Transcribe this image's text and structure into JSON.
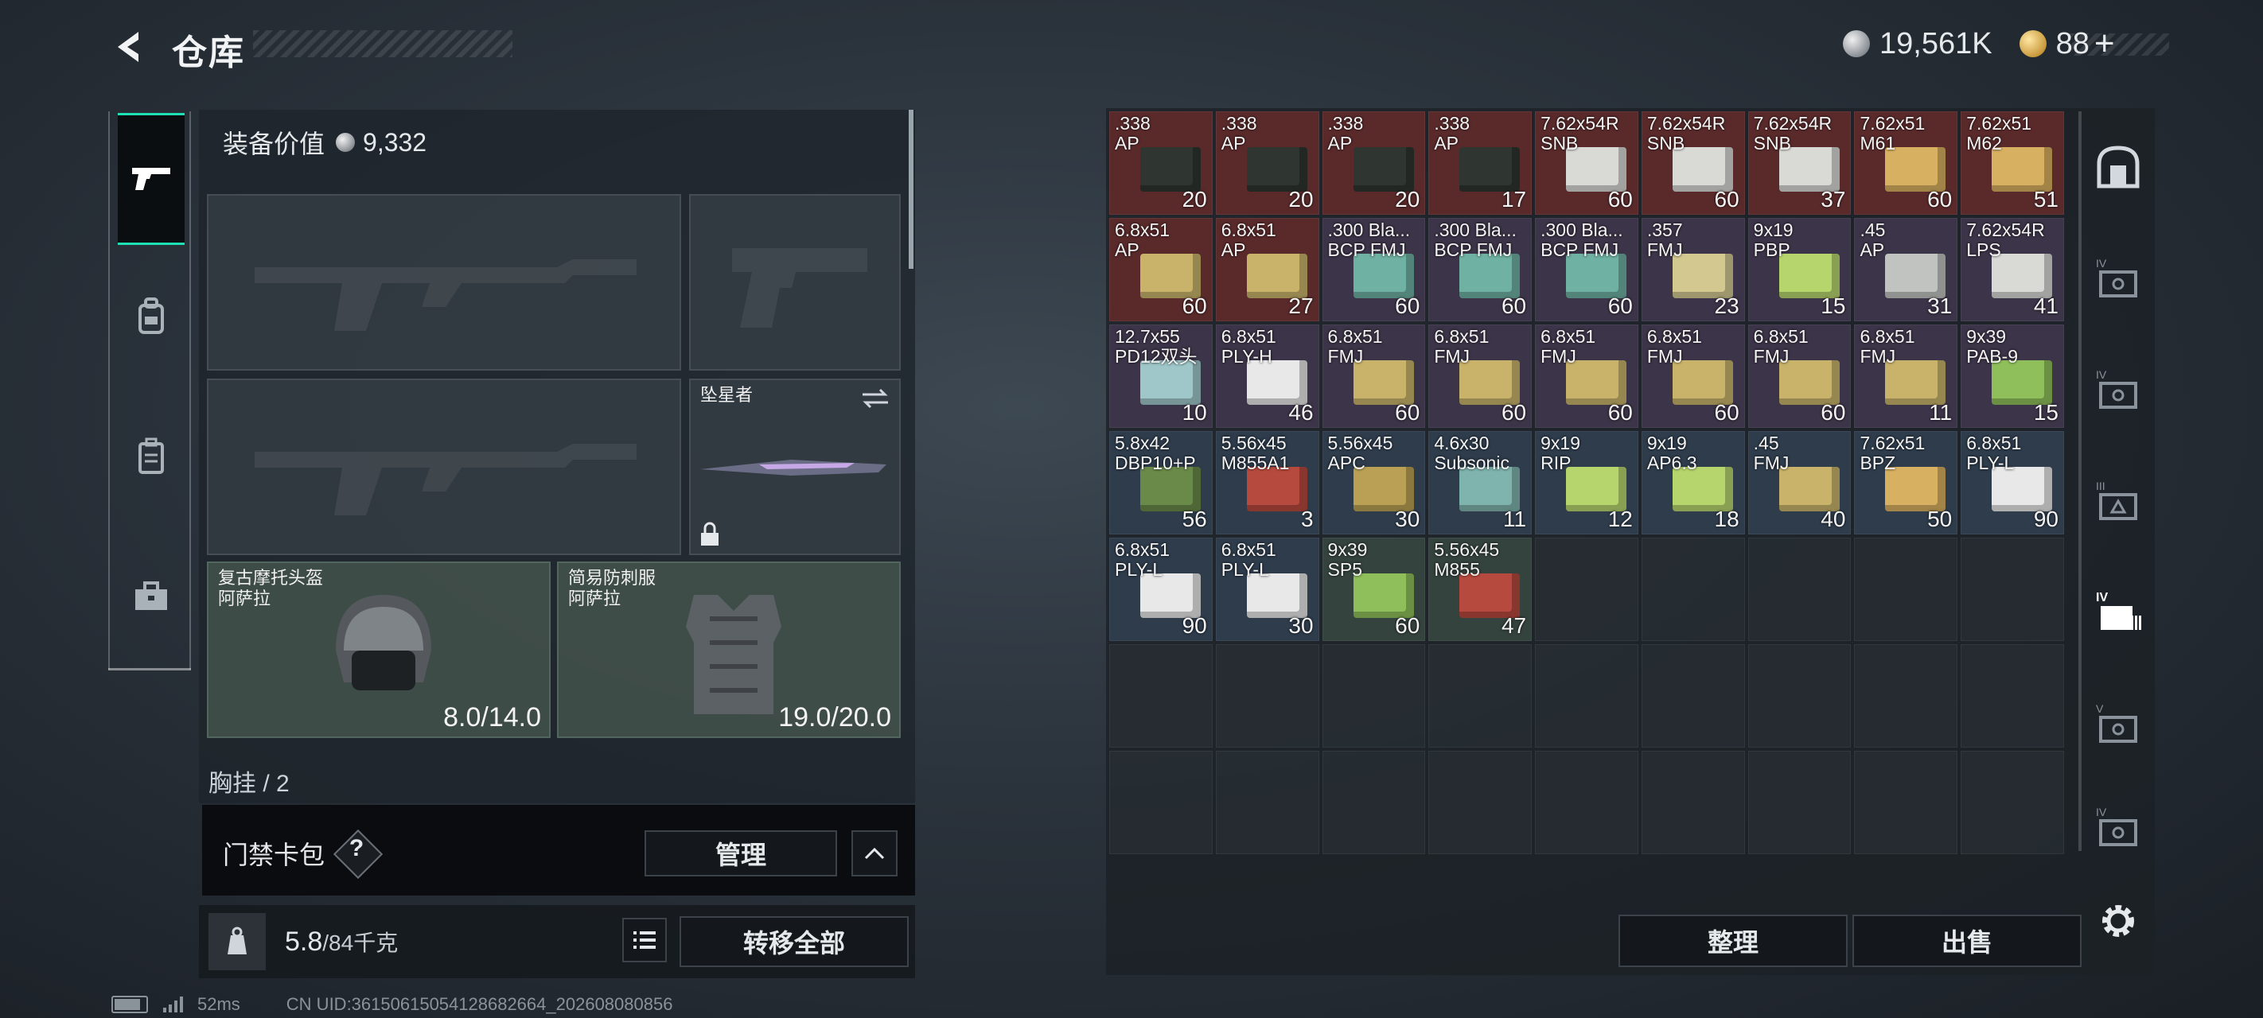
{
  "header": {
    "title": "仓库",
    "silver": "19,561K",
    "gold": "88",
    "gold_plus": "+"
  },
  "categories": [
    {
      "name": "weapons",
      "icon": "pistol-icon",
      "active": true
    },
    {
      "name": "gear",
      "icon": "backpack-icon",
      "active": false
    },
    {
      "name": "vest",
      "icon": "vest-icon",
      "active": false
    },
    {
      "name": "supplies",
      "icon": "toolbox-icon",
      "active": false
    }
  ],
  "equipment": {
    "value_label": "装备价值",
    "value": "9,332",
    "melee_name": "坠星者",
    "helmet": {
      "name": "复古摩托头盔",
      "brand": "阿萨拉",
      "durability": "8.0/14.0"
    },
    "armor": {
      "name": "简易防刺服",
      "brand": "阿萨拉",
      "durability": "19.0/20.0"
    },
    "partial_label": "胸挂 / 2"
  },
  "card_pack": {
    "label": "门禁卡包",
    "help": "?",
    "manage": "管理"
  },
  "weight": {
    "current": "5.8",
    "max": "/84千克",
    "transfer_all": "转移全部"
  },
  "warehouse": {
    "items": [
      {
        "n1": ".338",
        "n2": "AP",
        "q": "20",
        "rar": "red",
        "box": "#2f3530"
      },
      {
        "n1": ".338",
        "n2": "AP",
        "q": "20",
        "rar": "red",
        "box": "#2f3530"
      },
      {
        "n1": ".338",
        "n2": "AP",
        "q": "20",
        "rar": "red",
        "box": "#2f3530"
      },
      {
        "n1": ".338",
        "n2": "AP",
        "q": "17",
        "rar": "red",
        "box": "#2f3530"
      },
      {
        "n1": "7.62x54R",
        "n2": "SNB",
        "q": "60",
        "rar": "red",
        "box": "#d9dad6"
      },
      {
        "n1": "7.62x54R",
        "n2": "SNB",
        "q": "60",
        "rar": "red",
        "box": "#d9dad6"
      },
      {
        "n1": "7.62x54R",
        "n2": "SNB",
        "q": "37",
        "rar": "red",
        "box": "#d9dad6"
      },
      {
        "n1": "7.62x51",
        "n2": "M61",
        "q": "60",
        "rar": "red",
        "box": "#d8b062"
      },
      {
        "n1": "7.62x51",
        "n2": "M62",
        "q": "51",
        "rar": "red",
        "box": "#d8b062"
      },
      {
        "n1": "6.8x51",
        "n2": "AP",
        "q": "60",
        "rar": "red",
        "box": "#c9b36a"
      },
      {
        "n1": "6.8x51",
        "n2": "AP",
        "q": "27",
        "rar": "red",
        "box": "#c9b36a"
      },
      {
        "n1": ".300 Bla...",
        "n2": "BCP FMJ",
        "q": "60",
        "rar": "purple",
        "box": "#6fb1a2"
      },
      {
        "n1": ".300 Bla...",
        "n2": "BCP FMJ",
        "q": "60",
        "rar": "purple",
        "box": "#6fb1a2"
      },
      {
        "n1": ".300 Bla...",
        "n2": "BCP FMJ",
        "q": "60",
        "rar": "purple",
        "box": "#6fb1a2"
      },
      {
        "n1": ".357",
        "n2": "FMJ",
        "q": "23",
        "rar": "purple",
        "box": "#d3c890"
      },
      {
        "n1": "9x19",
        "n2": "PBP",
        "q": "15",
        "rar": "purple",
        "box": "#b7d56d"
      },
      {
        "n1": ".45",
        "n2": "AP",
        "q": "31",
        "rar": "purple",
        "box": "#c0c3bf"
      },
      {
        "n1": "7.62x54R",
        "n2": "LPS",
        "q": "41",
        "rar": "purple",
        "box": "#d9dad6"
      },
      {
        "n1": "12.7x55",
        "n2": "PD12双头",
        "q": "10",
        "rar": "purple",
        "box": "#9fc6c8"
      },
      {
        "n1": "6.8x51",
        "n2": "PLY-H",
        "q": "46",
        "rar": "purple",
        "box": "#e8e8e8"
      },
      {
        "n1": "6.8x51",
        "n2": "FMJ",
        "q": "60",
        "rar": "purple",
        "box": "#c9b36a"
      },
      {
        "n1": "6.8x51",
        "n2": "FMJ",
        "q": "60",
        "rar": "purple",
        "box": "#c9b36a"
      },
      {
        "n1": "6.8x51",
        "n2": "FMJ",
        "q": "60",
        "rar": "purple",
        "box": "#c9b36a"
      },
      {
        "n1": "6.8x51",
        "n2": "FMJ",
        "q": "60",
        "rar": "purple",
        "box": "#c9b36a"
      },
      {
        "n1": "6.8x51",
        "n2": "FMJ",
        "q": "60",
        "rar": "purple",
        "box": "#c9b36a"
      },
      {
        "n1": "6.8x51",
        "n2": "FMJ",
        "q": "11",
        "rar": "purple",
        "box": "#c9b36a"
      },
      {
        "n1": "9x39",
        "n2": "PAB-9",
        "q": "15",
        "rar": "purple",
        "box": "#8fbf5a"
      },
      {
        "n1": "5.8x42",
        "n2": "DBP10+P",
        "q": "56",
        "rar": "blue",
        "box": "#6a8a4a"
      },
      {
        "n1": "5.56x45",
        "n2": "M855A1",
        "q": "3",
        "rar": "blue",
        "box": "#b74a3e"
      },
      {
        "n1": "5.56x45",
        "n2": "APC",
        "q": "30",
        "rar": "blue",
        "box": "#b9a055"
      },
      {
        "n1": "4.6x30",
        "n2": "Subsonic",
        "q": "11",
        "rar": "blue",
        "box": "#7fb3ad"
      },
      {
        "n1": "9x19",
        "n2": "RIP",
        "q": "12",
        "rar": "blue",
        "box": "#b7d56d"
      },
      {
        "n1": "9x19",
        "n2": "AP6.3",
        "q": "18",
        "rar": "blue",
        "box": "#b7d56d"
      },
      {
        "n1": ".45",
        "n2": "FMJ",
        "q": "40",
        "rar": "blue",
        "box": "#c9b36a"
      },
      {
        "n1": "7.62x51",
        "n2": "BPZ",
        "q": "50",
        "rar": "blue",
        "box": "#d8b062"
      },
      {
        "n1": "6.8x51",
        "n2": "PLY-L",
        "q": "90",
        "rar": "blue",
        "box": "#e8e8e8"
      },
      {
        "n1": "6.8x51",
        "n2": "PLY-L",
        "q": "90",
        "rar": "blue",
        "box": "#e8e8e8"
      },
      {
        "n1": "6.8x51",
        "n2": "PLY-L",
        "q": "30",
        "rar": "blue",
        "box": "#e8e8e8"
      },
      {
        "n1": "9x39",
        "n2": "SP5",
        "q": "60",
        "rar": "green",
        "box": "#8fbf5a"
      },
      {
        "n1": "5.56x45",
        "n2": "M855",
        "q": "47",
        "rar": "green",
        "box": "#b74a3e"
      }
    ],
    "sort": "整理",
    "sell": "出售"
  },
  "cases": [
    {
      "icon": "safe-icon"
    },
    {
      "icon": "case-iv-icon"
    },
    {
      "icon": "case-iv-icon"
    },
    {
      "icon": "case-iii-icon"
    },
    {
      "icon": "case-iv-active-icon"
    },
    {
      "icon": "case-v-icon"
    },
    {
      "icon": "case-iv-icon"
    }
  ],
  "status": {
    "ping": "52ms",
    "uid": "CN UID:3615061505412868266​4_202608080856"
  }
}
